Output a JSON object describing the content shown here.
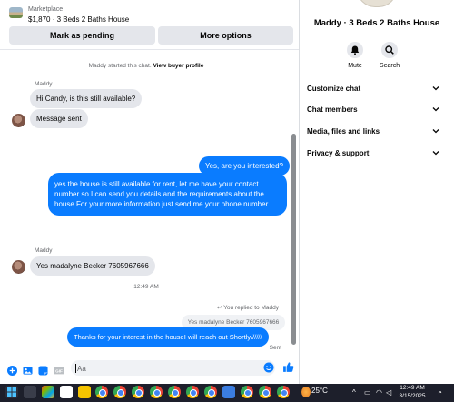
{
  "marketplace": {
    "source": "Marketplace",
    "item": "$1,870 · 3 Beds 2 Baths House",
    "pending_button": "Mark as pending",
    "options_button": "More options"
  },
  "system_message": {
    "text": "Maddy started this chat.",
    "link": "View buyer profile"
  },
  "messages": {
    "sender_1": "Maddy",
    "in_1": "Hi Candy, is this still available?",
    "in_2": "Message sent",
    "out_1": "Yes, are you interested?",
    "out_2": "yes the house is still available for rent, let me have your contact number so I can send you details and the requirements about the house For your more information just send me your phone number",
    "sender_2": "Maddy",
    "in_3": "Yes madalyne Becker 7605967666",
    "timestamp": "12:49 AM",
    "replied_label": "You replied to Maddy",
    "quoted": "Yes madalyne Becker 7605967666",
    "out_3": "Thanks for your interest in the houseI will reach out Shortly//////",
    "status": "Sent"
  },
  "composer": {
    "placeholder": "Aa"
  },
  "info_panel": {
    "title": "Maddy · 3 Beds 2 Baths House",
    "mute_label": "Mute",
    "search_label": "Search",
    "sections": [
      "Customize chat",
      "Chat members",
      "Media, files and links",
      "Privacy & support"
    ]
  },
  "taskbar": {
    "weather": "25°C",
    "time": "12:49 AM",
    "date": "3/15/2025"
  },
  "colors": {
    "accent": "#0a7cff",
    "bubble_in": "#e4e6eb",
    "taskbar": "#1d1f2b"
  }
}
